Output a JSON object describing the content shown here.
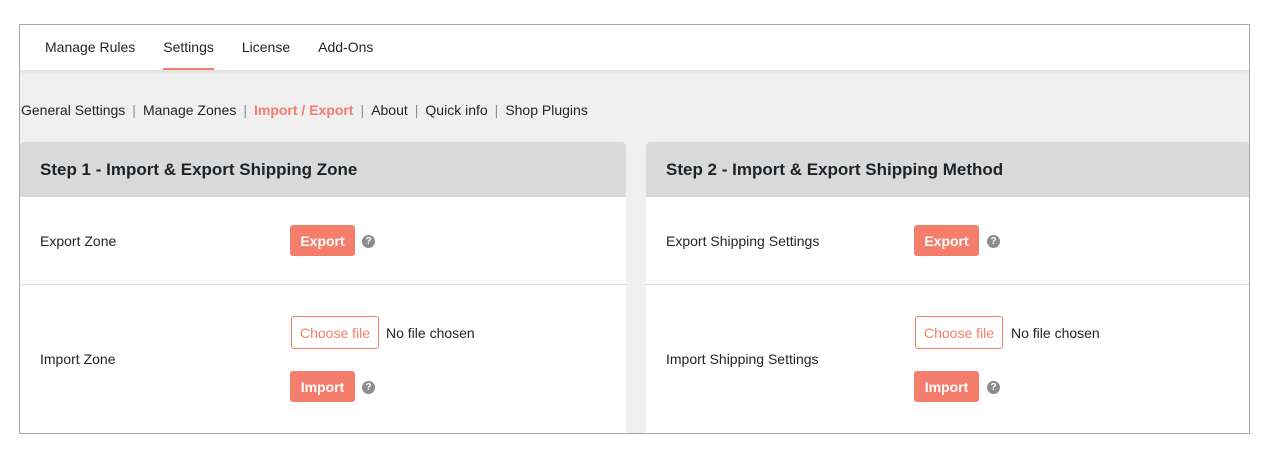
{
  "tabs": [
    {
      "label": "Manage Rules",
      "active": false
    },
    {
      "label": "Settings",
      "active": true
    },
    {
      "label": "License",
      "active": false
    },
    {
      "label": "Add-Ons",
      "active": false
    }
  ],
  "subnav": [
    {
      "label": "General Settings",
      "current": false
    },
    {
      "label": "Manage Zones",
      "current": false
    },
    {
      "label": "Import / Export",
      "current": true
    },
    {
      "label": "About",
      "current": false
    },
    {
      "label": "Quick info",
      "current": false
    },
    {
      "label": "Shop Plugins",
      "current": false
    }
  ],
  "subnav_separator": "|",
  "step1": {
    "title": "Step 1 - Import & Export Shipping Zone",
    "export_label": "Export Zone",
    "export_button": "Export",
    "import_label": "Import Zone",
    "choose_file": "Choose file",
    "file_status": "No file chosen",
    "import_button": "Import"
  },
  "step2": {
    "title": "Step 2 - Import & Export Shipping Method",
    "export_label": "Export Shipping Settings",
    "export_button": "Export",
    "import_label": "Import Shipping Settings",
    "choose_file": "Choose file",
    "file_status": "No file chosen",
    "import_button": "Import"
  },
  "help_glyph": "?",
  "colors": {
    "accent": "#f47d6b",
    "panel_header": "#d9d9d9",
    "background": "#f0f0f0"
  },
  "icons": {
    "help": "help-circle-icon"
  }
}
